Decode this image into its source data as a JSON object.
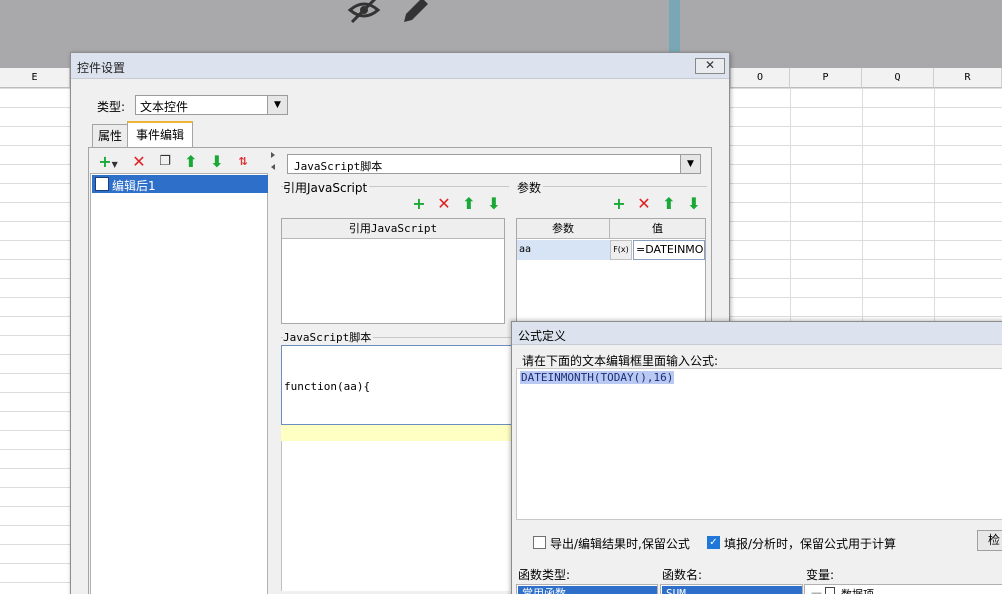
{
  "sheet": {
    "columns": [
      {
        "label": "E"
      },
      {
        "label": "O"
      },
      {
        "label": "P"
      },
      {
        "label": "Q"
      },
      {
        "label": "R"
      }
    ]
  },
  "top_toolbar": {
    "icons": [
      "eye-slash-icon",
      "pencil-icon"
    ]
  },
  "control_dialog": {
    "title": "控件设置",
    "close_label": "✕",
    "type_label": "类型:",
    "type_value": "文本控件",
    "tabs": [
      {
        "label": "属性",
        "active": false
      },
      {
        "label": "事件编辑",
        "active": true
      }
    ],
    "event_list": [
      {
        "label": "编辑后1",
        "selected": true
      }
    ],
    "script_type": "JavaScript脚本",
    "ref_js": {
      "group_label": "引用JavaScript",
      "column_header": "引用JavaScript"
    },
    "params": {
      "group_label": "参数",
      "headers": [
        "参数",
        "值"
      ],
      "rows": [
        {
          "name": "aa",
          "fx_label": "F(x)",
          "value": "=DATEINMO"
        }
      ]
    },
    "js_script": {
      "group_label": "JavaScript脚本",
      "code_line": "function(aa){"
    },
    "accent_color": "#f0b33a"
  },
  "formula_dialog": {
    "title": "公式定义",
    "prompt": "请在下面的文本编辑框里面输入公式:",
    "formula": "DATEINMONTH(TODAY(),16)",
    "checkbox_export": {
      "label": "导出/编辑结果时,保留公式",
      "checked": false
    },
    "checkbox_fill": {
      "label": "填报/分析时，保留公式用于计算",
      "checked": true
    },
    "check_button": "检",
    "fn_type_label": "函数类型:",
    "fn_name_label": "函数名:",
    "var_label": "变量:",
    "fn_type_selected": "常用函数",
    "fn_name_selected": "SUM",
    "var_item": "数据项"
  }
}
